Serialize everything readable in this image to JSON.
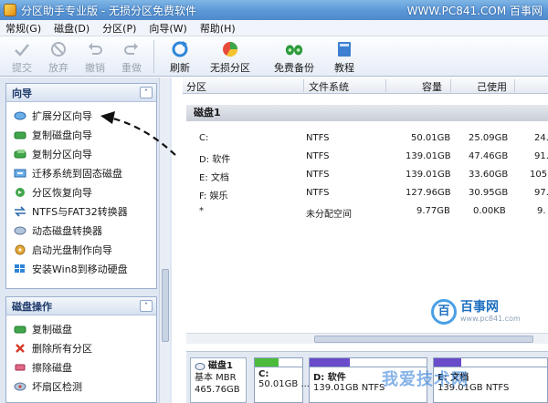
{
  "window": {
    "title": "分区助手专业版 - 无损分区免费软件",
    "watermark": "WWW.PC841.COM 百事网"
  },
  "menubar": {
    "items": [
      {
        "label": "常规(G)"
      },
      {
        "label": "磁盘(D)"
      },
      {
        "label": "分区(P)"
      },
      {
        "label": "向导(W)"
      },
      {
        "label": "帮助(H)"
      }
    ]
  },
  "toolbar": {
    "commit": "提交",
    "discard": "放弃",
    "undo": "撤销",
    "redo": "重做",
    "refresh": "刷新",
    "lossless": "无损分区",
    "backup": "免费备份",
    "tutorial": "教程"
  },
  "sidebar": {
    "wizard": {
      "title": "向导",
      "items": [
        {
          "label": "扩展分区向导"
        },
        {
          "label": "复制磁盘向导"
        },
        {
          "label": "复制分区向导"
        },
        {
          "label": "迁移系统到固态磁盘"
        },
        {
          "label": "分区恢复向导"
        },
        {
          "label": "NTFS与FAT32转换器"
        },
        {
          "label": "动态磁盘转换器"
        },
        {
          "label": "启动光盘制作向导"
        },
        {
          "label": "安装Win8到移动硬盘"
        }
      ]
    },
    "disk_ops": {
      "title": "磁盘操作",
      "items": [
        {
          "label": "复制磁盘"
        },
        {
          "label": "删除所有分区"
        },
        {
          "label": "擦除磁盘"
        },
        {
          "label": "坏扇区检测"
        }
      ]
    }
  },
  "table": {
    "headers": {
      "partition": "分区",
      "filesystem": "文件系统",
      "capacity": "容量",
      "used": "己使用",
      "extra": ""
    },
    "disk_label": "磁盘1",
    "rows": [
      {
        "name": "C:",
        "fs": "NTFS",
        "capacity": "50.01GB",
        "used": "25.09GB",
        "extra": "24."
      },
      {
        "name": "D: 软件",
        "fs": "NTFS",
        "capacity": "139.01GB",
        "used": "47.46GB",
        "extra": "91."
      },
      {
        "name": "E: 文档",
        "fs": "NTFS",
        "capacity": "139.01GB",
        "used": "33.60GB",
        "extra": "105."
      },
      {
        "name": "F: 娱乐",
        "fs": "NTFS",
        "capacity": "127.96GB",
        "used": "30.95GB",
        "extra": "97."
      },
      {
        "name": "*",
        "fs": "未分配空间",
        "capacity": "9.77GB",
        "used": "0.00KB",
        "extra": "9."
      }
    ]
  },
  "diskmap": {
    "disk": {
      "name": "磁盘1",
      "type": "基本 MBR",
      "size": "465.76GB"
    },
    "partitions": [
      {
        "name": "C:",
        "desc": "50.01GB ...",
        "fill": 0.5,
        "color": "#4cbb3c"
      },
      {
        "name": "D: 软件",
        "desc": "139.01GB NTFS",
        "fill": 0.34,
        "color": "#6a4bc9"
      },
      {
        "name": "E: 文档",
        "desc": "139.01GB NTFS",
        "fill": 0.24,
        "color": "#6a4bc9"
      }
    ]
  },
  "brand": {
    "name": "百事网",
    "url": "www.pc841.com",
    "circle": "百",
    "footer": "我爱技术网"
  }
}
